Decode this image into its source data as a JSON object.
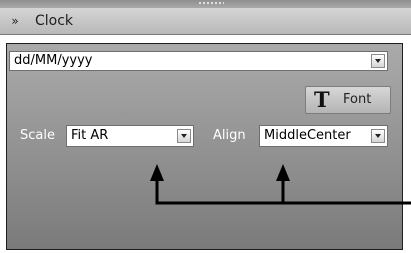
{
  "header": {
    "title": "Clock",
    "collapse_icon": "double-chevron-down-icon"
  },
  "format": {
    "value": "dd/MM/yyyy"
  },
  "font_button": {
    "label": "Font",
    "icon": "font-T-icon"
  },
  "scale": {
    "label": "Scale",
    "value": "Fit AR"
  },
  "align": {
    "label": "Align",
    "value": "MiddleCenter"
  },
  "annotation": {
    "color": "#000000"
  }
}
